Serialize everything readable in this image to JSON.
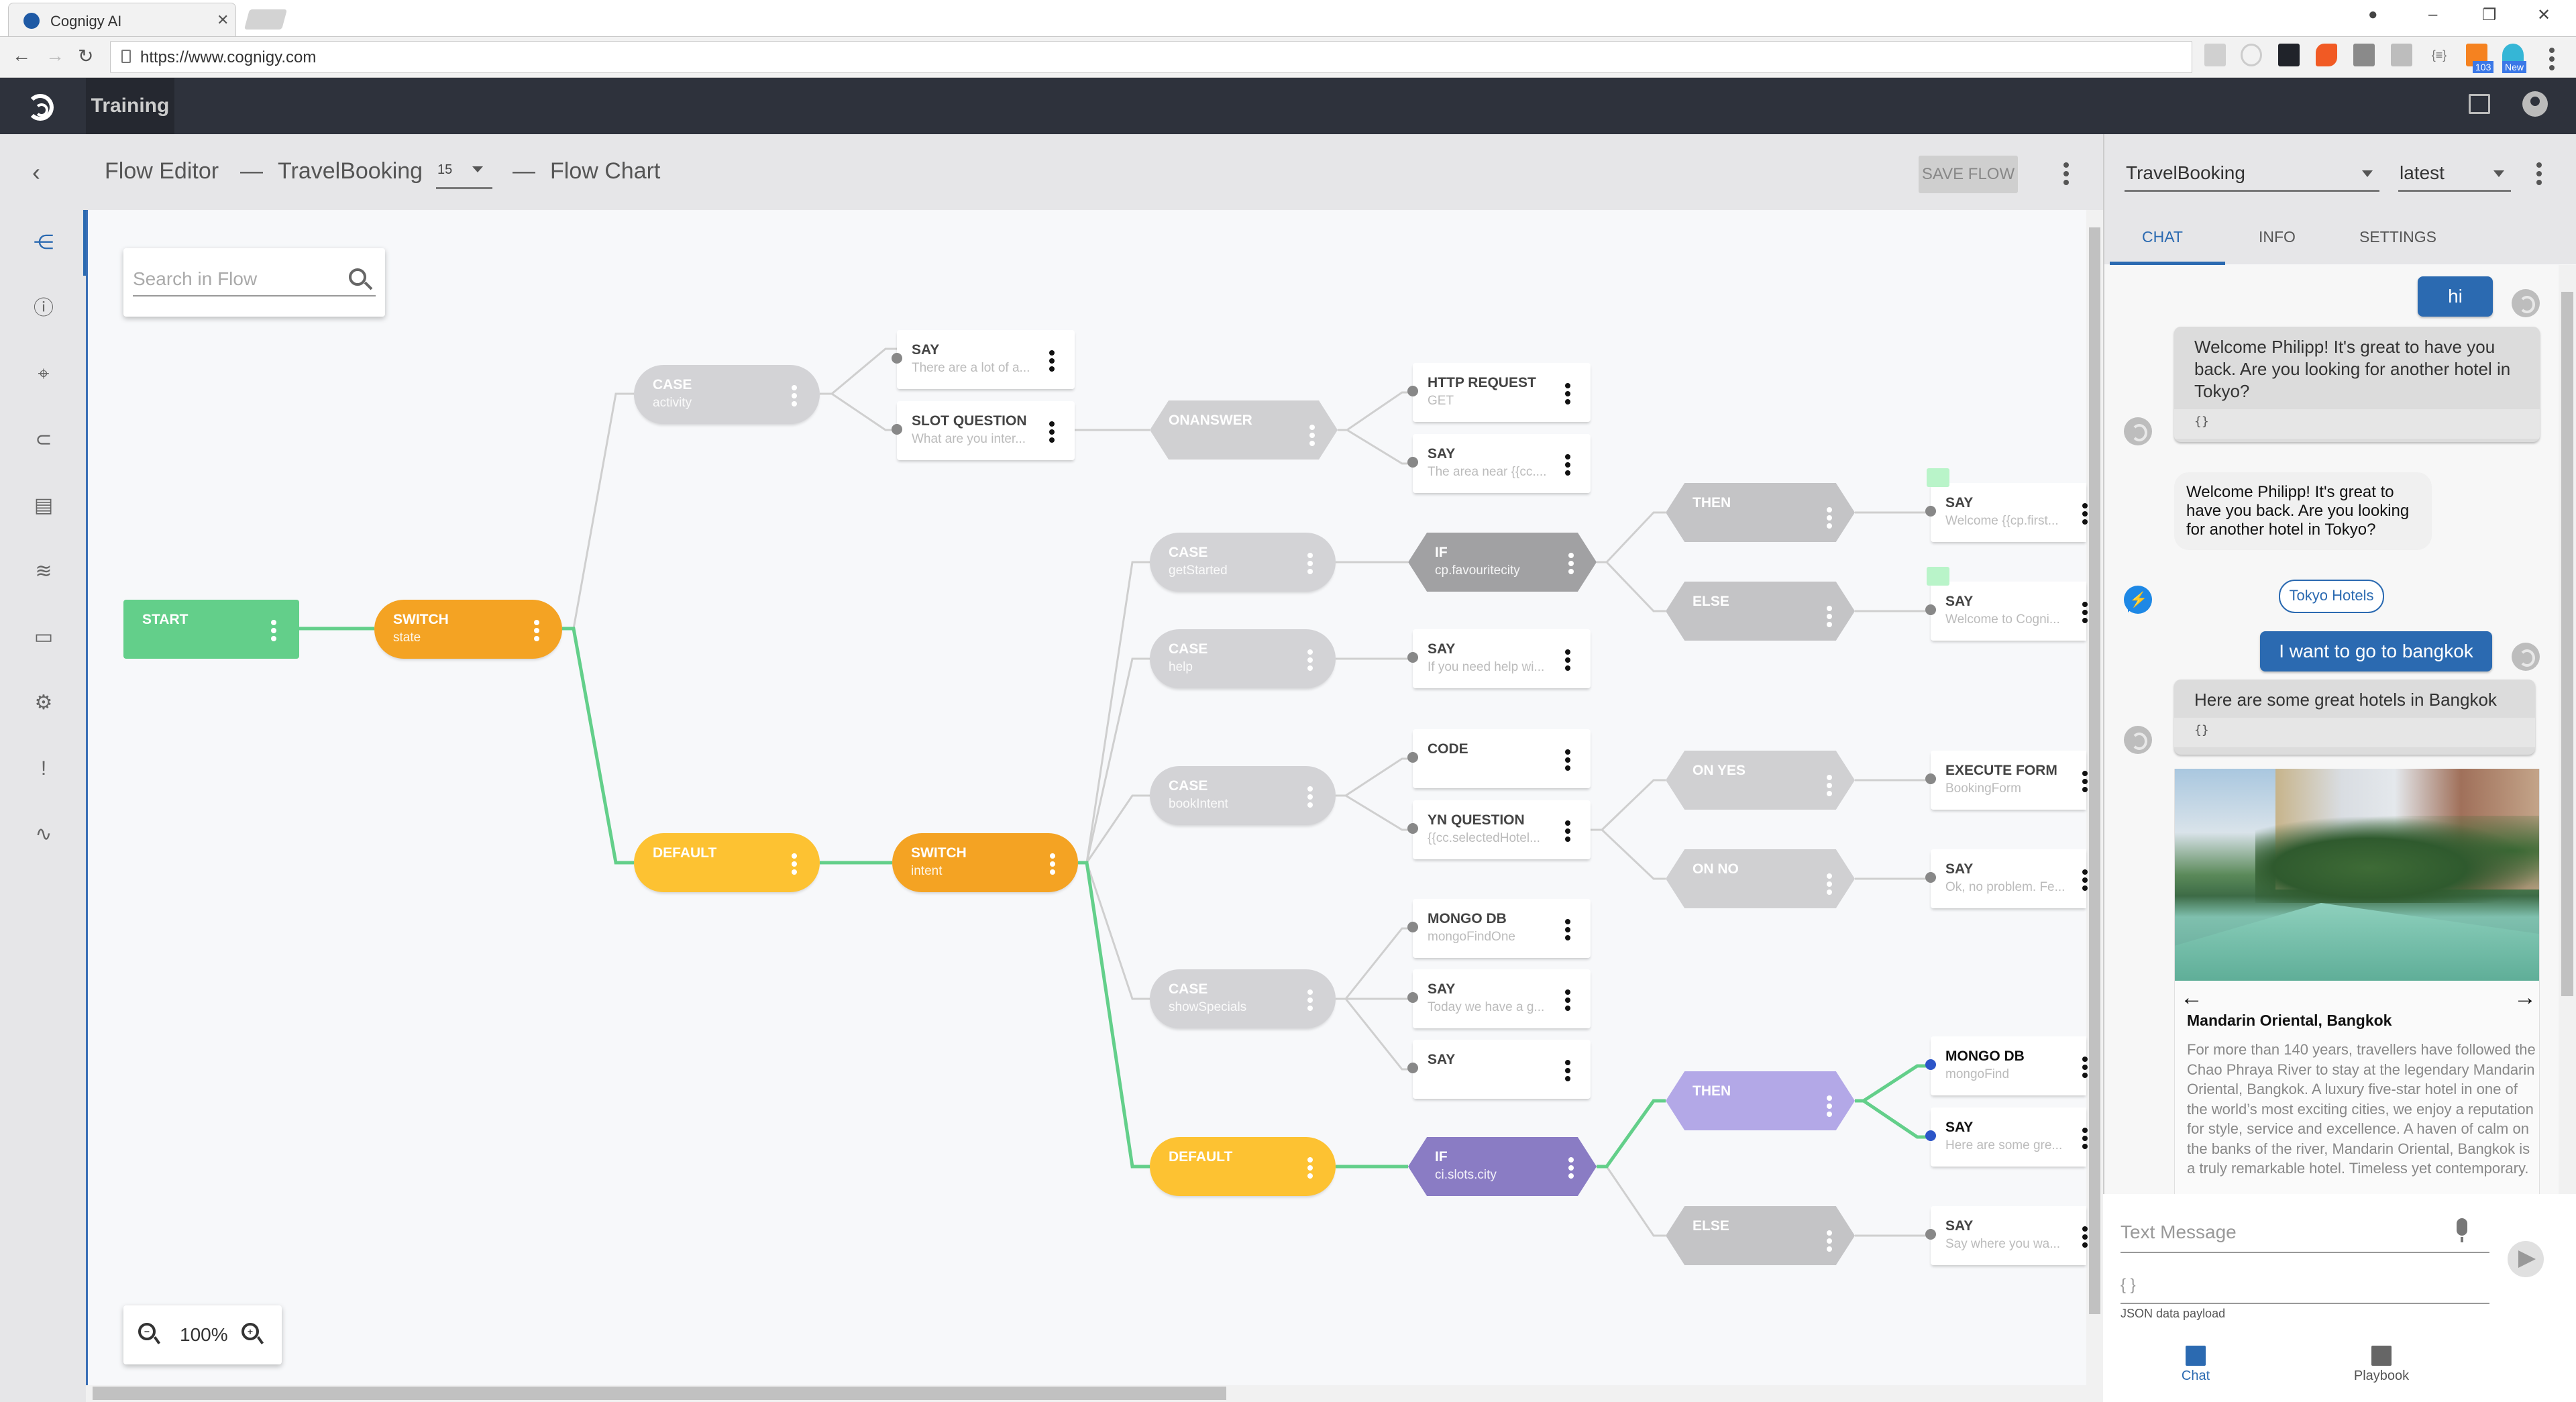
{
  "browser": {
    "tab_title": "Cognigy AI",
    "url": "https://www.cognigy.com",
    "extension_badges": [
      "103",
      "New"
    ]
  },
  "app_header": {
    "nav_item": "Training"
  },
  "sidebar": {
    "items": [
      {
        "icon": "flow-chart-icon",
        "active": true
      },
      {
        "icon": "info-icon"
      },
      {
        "icon": "intent-target-icon"
      },
      {
        "icon": "attachment-icon"
      },
      {
        "icon": "lexicon-icon"
      },
      {
        "icon": "layers-icon"
      },
      {
        "icon": "chat-bubble-icon"
      },
      {
        "icon": "gear-icon"
      },
      {
        "icon": "feedback-icon"
      },
      {
        "icon": "analytics-icon"
      }
    ]
  },
  "breadcrumb": {
    "section": "Flow Editor",
    "flow_name": "TravelBooking",
    "version": "15",
    "page": "Flow Chart",
    "separator": "—",
    "save_label": "SAVE FLOW"
  },
  "canvas": {
    "search_placeholder": "Search in Flow",
    "zoom_level": "100%",
    "nodes": {
      "start": {
        "title": "START"
      },
      "switch_state": {
        "title": "SWITCH",
        "sub": "state"
      },
      "case_activity": {
        "title": "CASE",
        "sub": "activity"
      },
      "say_activity": {
        "title": "SAY",
        "sub": "There are a lot of a..."
      },
      "slot_question": {
        "title": "SLOT QUESTION",
        "sub": "What are you inter..."
      },
      "onanswer": {
        "title": "ONANSWER"
      },
      "http_request": {
        "title": "HTTP REQUEST",
        "sub": "GET"
      },
      "say_area": {
        "title": "SAY",
        "sub": "The area near {{cc...."
      },
      "case_getstarted": {
        "title": "CASE",
        "sub": "getStarted"
      },
      "if_favcity": {
        "title": "IF",
        "sub": "cp.favouritecity"
      },
      "then_1": {
        "title": "THEN"
      },
      "else_1": {
        "title": "ELSE"
      },
      "say_welcome_first": {
        "title": "SAY",
        "sub": "Welcome {{cp.first..."
      },
      "say_welcome_cogni": {
        "title": "SAY",
        "sub": "Welcome to Cogni..."
      },
      "case_help": {
        "title": "CASE",
        "sub": "help"
      },
      "say_help": {
        "title": "SAY",
        "sub": "If you need help wi..."
      },
      "case_bookintent": {
        "title": "CASE",
        "sub": "bookIntent"
      },
      "code": {
        "title": "CODE"
      },
      "yn_question": {
        "title": "YN QUESTION",
        "sub": "{{cc.selectedHotel..."
      },
      "on_yes": {
        "title": "ON YES"
      },
      "on_no": {
        "title": "ON NO"
      },
      "execute_form": {
        "title": "EXECUTE FORM",
        "sub": "BookingForm"
      },
      "say_no_problem": {
        "title": "SAY",
        "sub": "Ok, no problem. Fe..."
      },
      "default_state": {
        "title": "DEFAULT"
      },
      "switch_intent": {
        "title": "SWITCH",
        "sub": "intent"
      },
      "mongo_findone": {
        "title": "MONGO DB",
        "sub": "mongoFindOne"
      },
      "case_showspecials": {
        "title": "CASE",
        "sub": "showSpecials"
      },
      "say_today": {
        "title": "SAY",
        "sub": "Today we have a g..."
      },
      "say_empty": {
        "title": "SAY"
      },
      "default_intent": {
        "title": "DEFAULT"
      },
      "if_city": {
        "title": "IF",
        "sub": "ci.slots.city"
      },
      "then_2": {
        "title": "THEN"
      },
      "else_2": {
        "title": "ELSE"
      },
      "mongo_find": {
        "title": "MONGO DB",
        "sub": "mongoFind"
      },
      "say_hotels": {
        "title": "SAY",
        "sub": "Here are some gre..."
      },
      "say_where": {
        "title": "SAY",
        "sub": "Say where you wa..."
      }
    }
  },
  "right_panel": {
    "flow_select": "TravelBooking",
    "version_select": "latest",
    "tabs": [
      "CHAT",
      "INFO",
      "SETTINGS"
    ],
    "active_tab": "CHAT",
    "messages": {
      "user_1": "hi",
      "bot_1": "Welcome Philipp! It's great to have you back. Are you looking for another hotel in Tokyo?",
      "bot_1_json": "{}",
      "fb_1": "Welcome Philipp! It's great to have you back. Are you looking for another hotel in Tokyo?",
      "quick_reply": "Tokyo Hotels",
      "user_2": "I want to go to bangkok",
      "bot_2": "Here are some great hotels in Bangkok",
      "bot_2_json": "{}"
    },
    "gallery_card": {
      "title": "Mandarin Oriental, Bangkok",
      "description": "For more than 140 years, travellers have followed the Chao Phraya River to stay at the legendary Mandarin Oriental, Bangkok. A luxury five-star hotel in one of the world’s most exciting cities, we enjoy a reputation for style, service and excellence. A haven of calm on the banks of the river, Mandarin Oriental, Bangkok is a truly remarkable hotel. Timeless yet contemporary."
    },
    "input": {
      "text_placeholder": "Text Message",
      "json_placeholder": "{ }",
      "json_label": "JSON data payload"
    },
    "bottom_tabs": [
      {
        "label": "Chat",
        "active": true
      },
      {
        "label": "Playbook",
        "active": false
      }
    ]
  },
  "colors": {
    "accent_blue": "#2b6ab1",
    "start_green": "#63cf8a",
    "switch_orange": "#f4a323",
    "default_yellow": "#fdc232",
    "if_purple": "#8a7cc4",
    "then_purple": "#b3a8e7",
    "active_edge": "#63cf8a",
    "header_dark": "#2e323c"
  }
}
